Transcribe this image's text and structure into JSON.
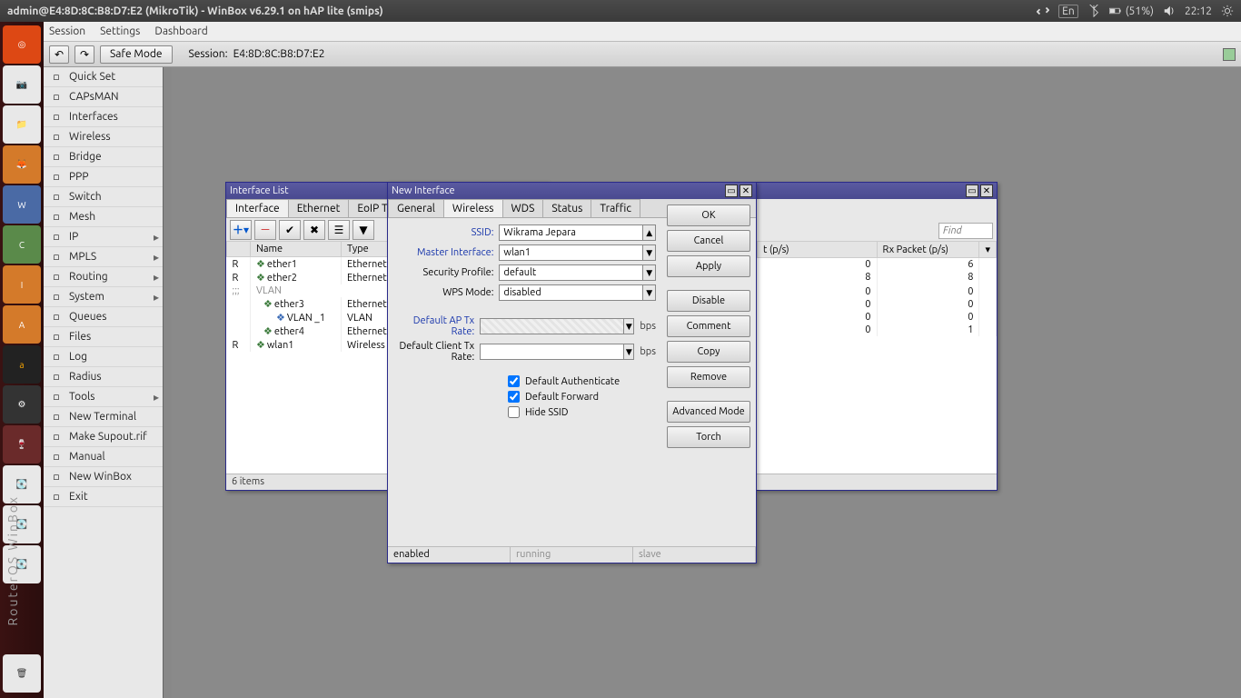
{
  "topbar": {
    "title": "admin@E4:8D:8C:B8:D7:E2 (MikroTik) - WinBox v6.29.1 on hAP lite (smips)",
    "lang": "En",
    "battery": "(51%)",
    "time": "22:12"
  },
  "menubar": {
    "session": "Session",
    "settings": "Settings",
    "dashboard": "Dashboard"
  },
  "toolbar": {
    "safe_mode": "Safe Mode",
    "session_label": "Session:",
    "session_value": "E4:8D:8C:B8:D7:E2"
  },
  "sidemenu": {
    "items": [
      {
        "label": "Quick Set"
      },
      {
        "label": "CAPsMAN"
      },
      {
        "label": "Interfaces"
      },
      {
        "label": "Wireless"
      },
      {
        "label": "Bridge"
      },
      {
        "label": "PPP"
      },
      {
        "label": "Switch"
      },
      {
        "label": "Mesh"
      },
      {
        "label": "IP",
        "arrow": true
      },
      {
        "label": "MPLS",
        "arrow": true
      },
      {
        "label": "Routing",
        "arrow": true
      },
      {
        "label": "System",
        "arrow": true
      },
      {
        "label": "Queues"
      },
      {
        "label": "Files"
      },
      {
        "label": "Log"
      },
      {
        "label": "Radius"
      },
      {
        "label": "Tools",
        "arrow": true
      },
      {
        "label": "New Terminal"
      },
      {
        "label": "Make Supout.rif"
      },
      {
        "label": "Manual"
      },
      {
        "label": "New WinBox"
      },
      {
        "label": "Exit"
      }
    ],
    "side_text": "RouterOS WinBox"
  },
  "interface_list": {
    "title": "Interface List",
    "tabs": [
      "Interface",
      "Ethernet",
      "EoIP Tunnel"
    ],
    "cols": {
      "flag": "",
      "name": "Name",
      "type": "Type"
    },
    "rows": [
      {
        "flag": "R",
        "name": "ether1",
        "type": "Ethernet",
        "kind": "if"
      },
      {
        "flag": "R",
        "name": "ether2",
        "type": "Ethernet",
        "kind": "if"
      },
      {
        "flag": ";;;",
        "name": "VLAN",
        "type": "",
        "kind": "comment"
      },
      {
        "flag": "",
        "name": "ether3",
        "type": "Ethernet",
        "kind": "if"
      },
      {
        "flag": "",
        "name": "VLAN _1",
        "type": "VLAN",
        "kind": "vlan"
      },
      {
        "flag": "",
        "name": "ether4",
        "type": "Ethernet",
        "kind": "if"
      },
      {
        "flag": "R",
        "name": "wlan1",
        "type": "Wireless",
        "kind": "if"
      }
    ],
    "status": "6 items"
  },
  "stats_window": {
    "find_placeholder": "Find",
    "cols": {
      "tx": "t (p/s)",
      "rx": "Rx Packet (p/s)"
    },
    "rows": [
      {
        "tx": "0",
        "rx": "6"
      },
      {
        "tx": "8",
        "rx": "8"
      },
      {
        "tx": "",
        "rx": ""
      },
      {
        "tx": "0",
        "rx": "0"
      },
      {
        "tx": "0",
        "rx": "0"
      },
      {
        "tx": "0",
        "rx": "0"
      },
      {
        "tx": "0",
        "rx": "1"
      }
    ]
  },
  "new_interface": {
    "title": "New Interface",
    "tabs": [
      "General",
      "Wireless",
      "WDS",
      "Status",
      "Traffic"
    ],
    "active_tab": "Wireless",
    "fields": {
      "ssid_label": "SSID:",
      "ssid": "Wikrama Jepara",
      "master_label": "Master Interface:",
      "master": "wlan1",
      "secprof_label": "Security Profile:",
      "secprof": "default",
      "wps_label": "WPS Mode:",
      "wps": "disabled",
      "apTx_label": "Default AP Tx Rate:",
      "apTx": "",
      "clientTx_label": "Default Client Tx Rate:",
      "clientTx": "",
      "bps": "bps",
      "c1": "Default Authenticate",
      "c2": "Default Forward",
      "c3": "Hide SSID"
    },
    "buttons": {
      "ok": "OK",
      "cancel": "Cancel",
      "apply": "Apply",
      "disable": "Disable",
      "comment": "Comment",
      "copy": "Copy",
      "remove": "Remove",
      "adv": "Advanced Mode",
      "torch": "Torch"
    },
    "status": {
      "enabled": "enabled",
      "running": "running",
      "slave": "slave"
    }
  }
}
